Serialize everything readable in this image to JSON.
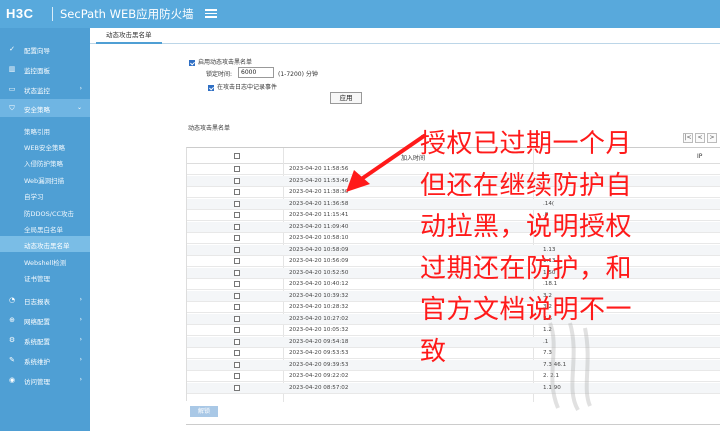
{
  "header": {
    "logo": "H3C",
    "title": "SecPath WEB应用防火墙"
  },
  "sidebar": {
    "items": [
      {
        "label": "配置向导",
        "icon": "wand-icon"
      },
      {
        "label": "监控面板",
        "icon": "dashboard-icon"
      },
      {
        "label": "状态监控",
        "icon": "monitor-icon",
        "chevron": "›"
      },
      {
        "label": "安全策略",
        "icon": "shield-icon",
        "chevron": "⌄"
      }
    ],
    "sub_items": [
      "策略引用",
      "WEB安全策略",
      "入侵防护策略",
      "Web漏洞扫描",
      "自学习",
      "防DDOS/CC攻击",
      "全局黑白名单",
      "动态攻击黑名单",
      "Webshell检测",
      "证书管理"
    ],
    "bottom_items": [
      {
        "label": "日志报表",
        "icon": "report-icon",
        "chevron": "›"
      },
      {
        "label": "网络配置",
        "icon": "network-icon",
        "chevron": "›"
      },
      {
        "label": "系统配置",
        "icon": "gear-icon",
        "chevron": "›"
      },
      {
        "label": "系统维护",
        "icon": "wrench-icon",
        "chevron": "›"
      },
      {
        "label": "访问管理",
        "icon": "lock-icon",
        "chevron": "›"
      }
    ]
  },
  "tab": {
    "label": "动态攻击黑名单"
  },
  "settings": {
    "enable_label": "启用动态攻击黑名单",
    "period_label": "锁定时间:",
    "period_value": "6000",
    "period_hint": "(1-7200)  分钟",
    "log_label": "在攻击日志中记录事件",
    "apply_label": "应用"
  },
  "list": {
    "title": "动态攻击黑名单",
    "col_time": "加入时间",
    "col_ip": "IP",
    "pager": [
      "|<",
      "<",
      ">",
      ">|"
    ],
    "rows": [
      {
        "time": "2023-04-20 11:58:56",
        "ip": ""
      },
      {
        "time": "2023-04-20 11:53:46",
        "ip": ""
      },
      {
        "time": "2023-04-20 11:38:30",
        "ip": ""
      },
      {
        "time": "2023-04-20 11:36:58",
        "ip": ".14("
      },
      {
        "time": "2023-04-20 11:15:41",
        "ip": ".0"
      },
      {
        "time": "2023-04-20 11:09:40",
        "ip": ""
      },
      {
        "time": "2023-04-20 10:58:10",
        "ip": ""
      },
      {
        "time": "2023-04-20 10:58:09",
        "ip": "1.13"
      },
      {
        "time": "2023-04-20 10:56:09",
        "ip": "1.13"
      },
      {
        "time": "2023-04-20 10:52:50",
        "ip": "1.50"
      },
      {
        "time": "2023-04-20 10:40:12",
        "ip": ".18.1"
      },
      {
        "time": "2023-04-20 10:39:32",
        "ip": "3.2"
      },
      {
        "time": "2023-04-20 10:28:32",
        "ip": "3.2"
      },
      {
        "time": "2023-04-20 10:27:02",
        "ip": "3.6"
      },
      {
        "time": "2023-04-20 10:05:32",
        "ip": "1.2"
      },
      {
        "time": "2023-04-20 09:54:18",
        "ip": ".1"
      },
      {
        "time": "2023-04-20 09:53:53",
        "ip": "7.3"
      },
      {
        "time": "2023-04-20 09:39:53",
        "ip": "7.3  46.1"
      },
      {
        "time": "2023-04-20 09:22:02",
        "ip": "2.  2.1"
      },
      {
        "time": "2023-04-20 08:57:02",
        "ip": "1.1  90"
      }
    ],
    "unlock_label": "解锁"
  },
  "annotation": {
    "color": "#ff1a1a",
    "lines": [
      "授权已过期一个月",
      "但还在继续防护自",
      "动拉黑，说明授权",
      "过期还在防护，和",
      "官方文档说明不一",
      "致"
    ]
  }
}
